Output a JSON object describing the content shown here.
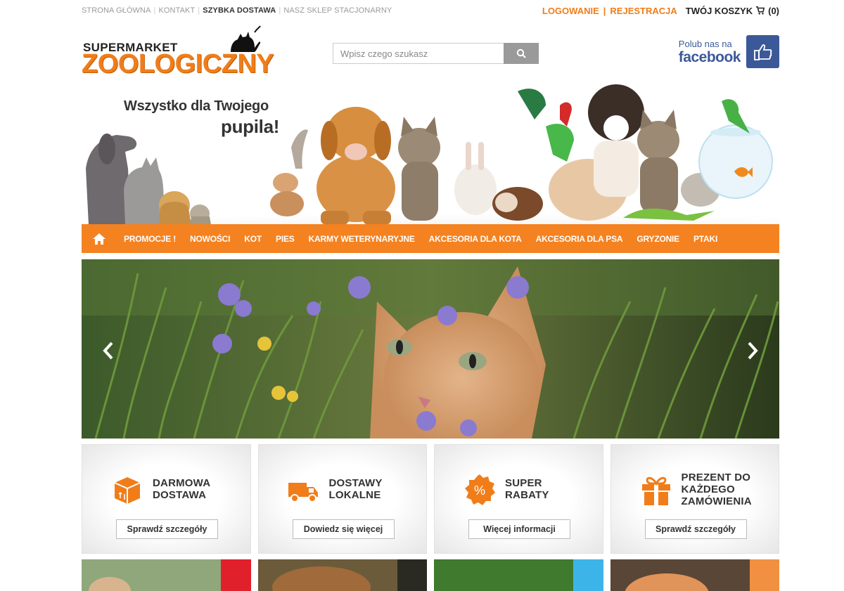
{
  "topbar": {
    "links": [
      {
        "label": "STRONA GŁÓWNA"
      },
      {
        "label": "KONTAKT"
      },
      {
        "label": "SZYBKA DOSTAWA"
      },
      {
        "label": "NASZ SKLEP STACJONARNY"
      }
    ],
    "login_label": "LOGOWANIE",
    "register_label": "REJESTRACJA",
    "cart_label": "TWÓJ KOSZYK",
    "cart_count": "(0)"
  },
  "header": {
    "logo_small": "SUPERMARKET",
    "logo_big": "ZOOLOGICZNY",
    "search_placeholder": "Wpisz czego szukasz",
    "facebook_line1": "Polub nas na",
    "facebook_line2": "facebook",
    "tagline_line1": "Wszystko dla Twojego",
    "tagline_line2": "pupila!"
  },
  "nav": {
    "items": [
      {
        "label": "PROMOCJE !"
      },
      {
        "label": "NOWOŚCI"
      },
      {
        "label": "KOT"
      },
      {
        "label": "PIES"
      },
      {
        "label": "KARMY WETERYNARYJNE"
      },
      {
        "label": "AKCESORIA DLA KOTA"
      },
      {
        "label": "AKCESORIA DLA PSA"
      },
      {
        "label": "GRYZONIE"
      },
      {
        "label": "PTAKI"
      }
    ]
  },
  "features": [
    {
      "title_line1": "DARMOWA",
      "title_line2": "DOSTAWA",
      "title_line3": "",
      "icon": "box-icon",
      "button": "Sprawdź szczegóły"
    },
    {
      "title_line1": "DOSTAWY",
      "title_line2": "LOKALNE",
      "title_line3": "",
      "icon": "truck-icon",
      "button": "Dowiedz się więcej"
    },
    {
      "title_line1": "SUPER",
      "title_line2": "RABATY",
      "title_line3": "",
      "icon": "percent-badge-icon",
      "button": "Więcej informacji"
    },
    {
      "title_line1": "PREZENT DO",
      "title_line2": "KAŻDEGO",
      "title_line3": "ZAMÓWIENIA",
      "icon": "gift-icon",
      "button": "Sprawdź szczegóły"
    }
  ],
  "colors": {
    "accent": "#f58220",
    "brand_orange": "#f07d1a",
    "facebook": "#3b5998",
    "tile_accents": [
      "#e0202a",
      "#2a2a22",
      "#3cb4e8",
      "#f09040"
    ]
  }
}
